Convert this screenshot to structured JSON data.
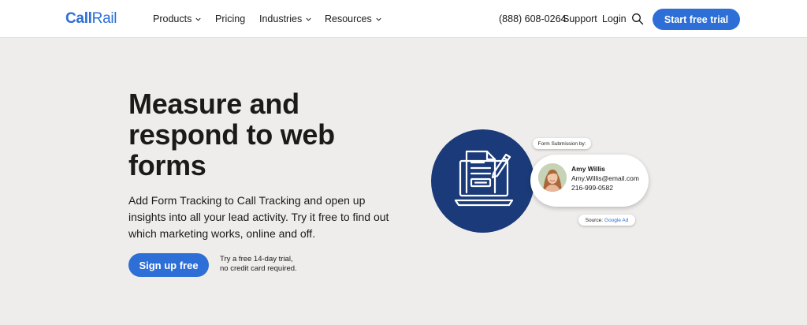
{
  "header": {
    "logo_call": "Call",
    "logo_rail": "Rail",
    "nav": [
      {
        "label": "Products",
        "has_dropdown": true
      },
      {
        "label": "Pricing",
        "has_dropdown": false
      },
      {
        "label": "Industries",
        "has_dropdown": true
      },
      {
        "label": "Resources",
        "has_dropdown": true
      }
    ],
    "phone": "(888) 608-0264",
    "support": "Support",
    "login": "Login",
    "search_icon": "search-icon",
    "cta": "Start free trial"
  },
  "hero": {
    "title": "Measure and respond to web forms",
    "description": "Add Form Tracking to Call Tracking and open up insights into all your lead activity. Try it free to find out which marketing works, online and off.",
    "signup": "Sign up free",
    "trial_line1": "Try a free 14-day trial,",
    "trial_line2": "no credit card required."
  },
  "illustration": {
    "submission_label": "Form Submission by:",
    "contact_name": "Amy Willis",
    "contact_email": "Amy.Willis@email.com",
    "contact_phone": "216-999-0582",
    "source_label": "Source:",
    "source_value": "Google Ad"
  },
  "colors": {
    "brand_blue": "#2d6fd6",
    "navy": "#1a3a7a",
    "background": "#efedeb"
  }
}
